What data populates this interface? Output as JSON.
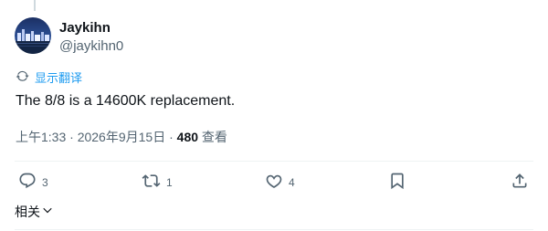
{
  "author": {
    "name": "Jaykihn",
    "handle": "@jaykihn0"
  },
  "translate": {
    "label": "显示翻译"
  },
  "tweet": {
    "text": "The 8/8 is a 14600K replacement."
  },
  "meta": {
    "time": "上午1:33",
    "separator": "·",
    "date": "2026年9月15日",
    "views_count": "480",
    "views_label": "查看"
  },
  "actions": {
    "reply_count": "3",
    "retweet_count": "1",
    "like_count": "4"
  },
  "related": {
    "label": "相关"
  },
  "colors": {
    "accent": "#1d9bf0",
    "icon": "#536471",
    "text": "#0f1419",
    "divider": "#eff3f4"
  }
}
